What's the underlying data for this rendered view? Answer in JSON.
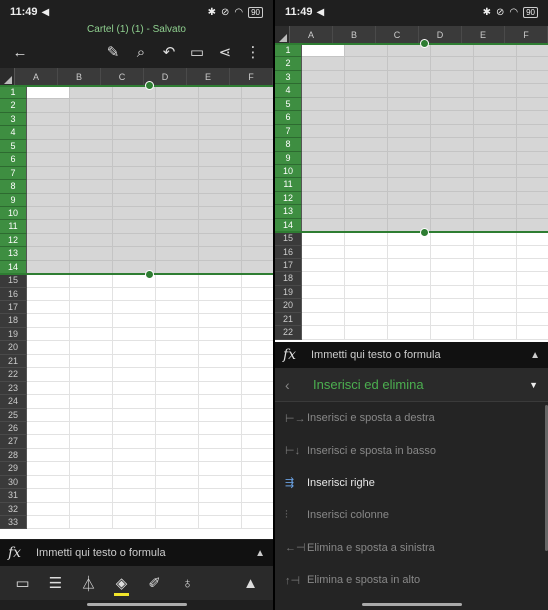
{
  "status": {
    "time": "11:49",
    "battery": "90"
  },
  "title": "Cartel (1) (1) - Salvato",
  "icons": {
    "back": "back-arrow-icon",
    "pen": "draw-pen-icon",
    "search": "search-icon",
    "undo": "undo-icon",
    "comment": "comment-icon",
    "share": "share-icon",
    "more": "more-vertical-icon"
  },
  "columns": [
    "A",
    "B",
    "C",
    "D",
    "E",
    "F"
  ],
  "left_rows": [
    "1",
    "2",
    "3",
    "4",
    "5",
    "6",
    "7",
    "8",
    "9",
    "10",
    "11",
    "12",
    "13",
    "14",
    "15",
    "16",
    "17",
    "18",
    "19",
    "20",
    "21",
    "22",
    "23",
    "24",
    "25",
    "26",
    "27",
    "28",
    "29",
    "30",
    "31",
    "32",
    "33"
  ],
  "right_rows": [
    "1",
    "2",
    "3",
    "4",
    "5",
    "6",
    "7",
    "8",
    "9",
    "10",
    "11",
    "12",
    "13",
    "14",
    "15",
    "16",
    "17",
    "18",
    "19",
    "20",
    "21",
    "22"
  ],
  "selected_rows": 14,
  "formula": {
    "placeholder": "Immetti qui testo o formula"
  },
  "bottom_toolbar": [
    "presentation-icon",
    "card-view-icon",
    "filter-icon",
    "fill-color-icon",
    "brush-icon",
    "lightbulb-icon"
  ],
  "colors": {
    "accent": "#2e7d32",
    "fill_swatch": "#f2e52b",
    "menu_title": "#4caf50"
  },
  "menu": {
    "title": "Inserisci ed elimina",
    "items": [
      {
        "label": "Inserisci e sposta a destra",
        "enabled": false
      },
      {
        "label": "Inserisci e sposta in basso",
        "enabled": false
      },
      {
        "label": "Inserisci righe",
        "enabled": true
      },
      {
        "label": "Inserisci colonne",
        "enabled": false
      },
      {
        "label": "Elimina e sposta a sinistra",
        "enabled": false
      },
      {
        "label": "Elimina e sposta in alto",
        "enabled": false
      }
    ]
  }
}
